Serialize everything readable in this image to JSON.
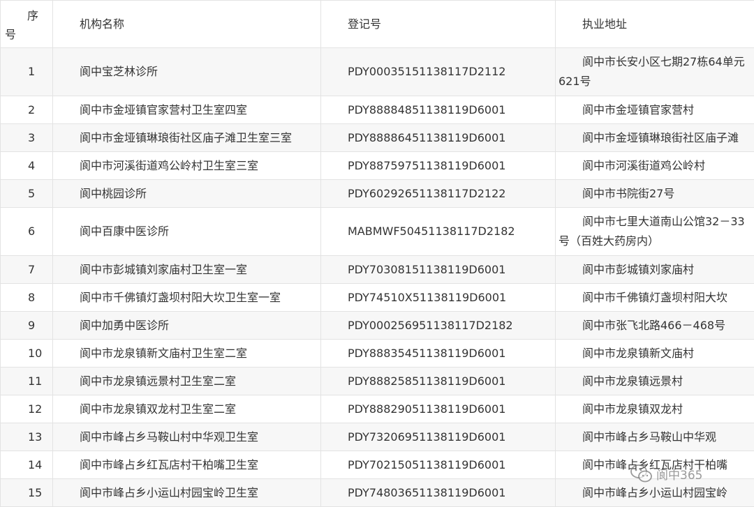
{
  "table": {
    "headers": {
      "no_line1": "序",
      "no_line2": "号",
      "name": "机构名称",
      "reg": "登记号",
      "addr": "执业地址"
    },
    "rows": [
      {
        "no": "1",
        "name": "阆中宝芝林诊所",
        "reg": "PDY00035151138117D2112",
        "addr": "阆中市长安小区七期27栋64单元621号"
      },
      {
        "no": "2",
        "name": "阆中市金垭镇官家营村卫生室四室",
        "reg": "PDY88884851138119D6001",
        "addr": "阆中市金垭镇官家营村"
      },
      {
        "no": "3",
        "name": "阆中市金垭镇琳琅街社区庙子滩卫生室三室",
        "reg": "PDY88886451138119D6001",
        "addr": "阆中市金垭镇琳琅街社区庙子滩"
      },
      {
        "no": "4",
        "name": "阆中市河溪街道鸡公岭村卫生室三室",
        "reg": "PDY88759751138119D6001",
        "addr": "阆中市河溪街道鸡公岭村"
      },
      {
        "no": "5",
        "name": "阆中桃园诊所",
        "reg": "PDY60292651138117D2122",
        "addr": "阆中市书院街27号"
      },
      {
        "no": "6",
        "name": "阆中百康中医诊所",
        "reg": "MABMWF50451138117D2182",
        "addr": "阆中市七里大道南山公馆32－33号（百姓大药房内）"
      },
      {
        "no": "7",
        "name": "阆中市彭城镇刘家庙村卫生室一室",
        "reg": "PDY70308151138119D6001",
        "addr": "阆中市彭城镇刘家庙村"
      },
      {
        "no": "8",
        "name": "阆中市千佛镇灯盏坝村阳大坎卫生室一室",
        "reg": "PDY74510X51138119D6001",
        "addr": "阆中市千佛镇灯盏坝村阳大坎"
      },
      {
        "no": "9",
        "name": "阆中加勇中医诊所",
        "reg": "PDY000256951138117D2182",
        "addr": "阆中市张飞北路466－468号"
      },
      {
        "no": "10",
        "name": "阆中市龙泉镇新文庙村卫生室二室",
        "reg": "PDY88835451138119D6001",
        "addr": "阆中市龙泉镇新文庙村"
      },
      {
        "no": "11",
        "name": "阆中市龙泉镇远景村卫生室二室",
        "reg": "PDY88825851138119D6001",
        "addr": "阆中市龙泉镇远景村"
      },
      {
        "no": "12",
        "name": "阆中市龙泉镇双龙村卫生室二室",
        "reg": "PDY88829051138119D6001",
        "addr": "阆中市龙泉镇双龙村"
      },
      {
        "no": "13",
        "name": "阆中市峰占乡马鞍山村中华观卫生室",
        "reg": "PDY73206951138119D6001",
        "addr": "阆中市峰占乡马鞍山中华观"
      },
      {
        "no": "14",
        "name": "阆中市峰占乡红瓦店村干柏嘴卫生室",
        "reg": "PDY70215051138119D6001",
        "addr": "阆中市峰占乡红瓦店村干柏嘴"
      },
      {
        "no": "15",
        "name": "阆中市峰占乡小运山村园宝岭卫生室",
        "reg": "PDY74803651138119D6001",
        "addr": "阆中市峰占乡小运山村园宝岭"
      }
    ]
  },
  "watermark": {
    "text": "阆中365",
    "icon": "wechat-icon"
  }
}
